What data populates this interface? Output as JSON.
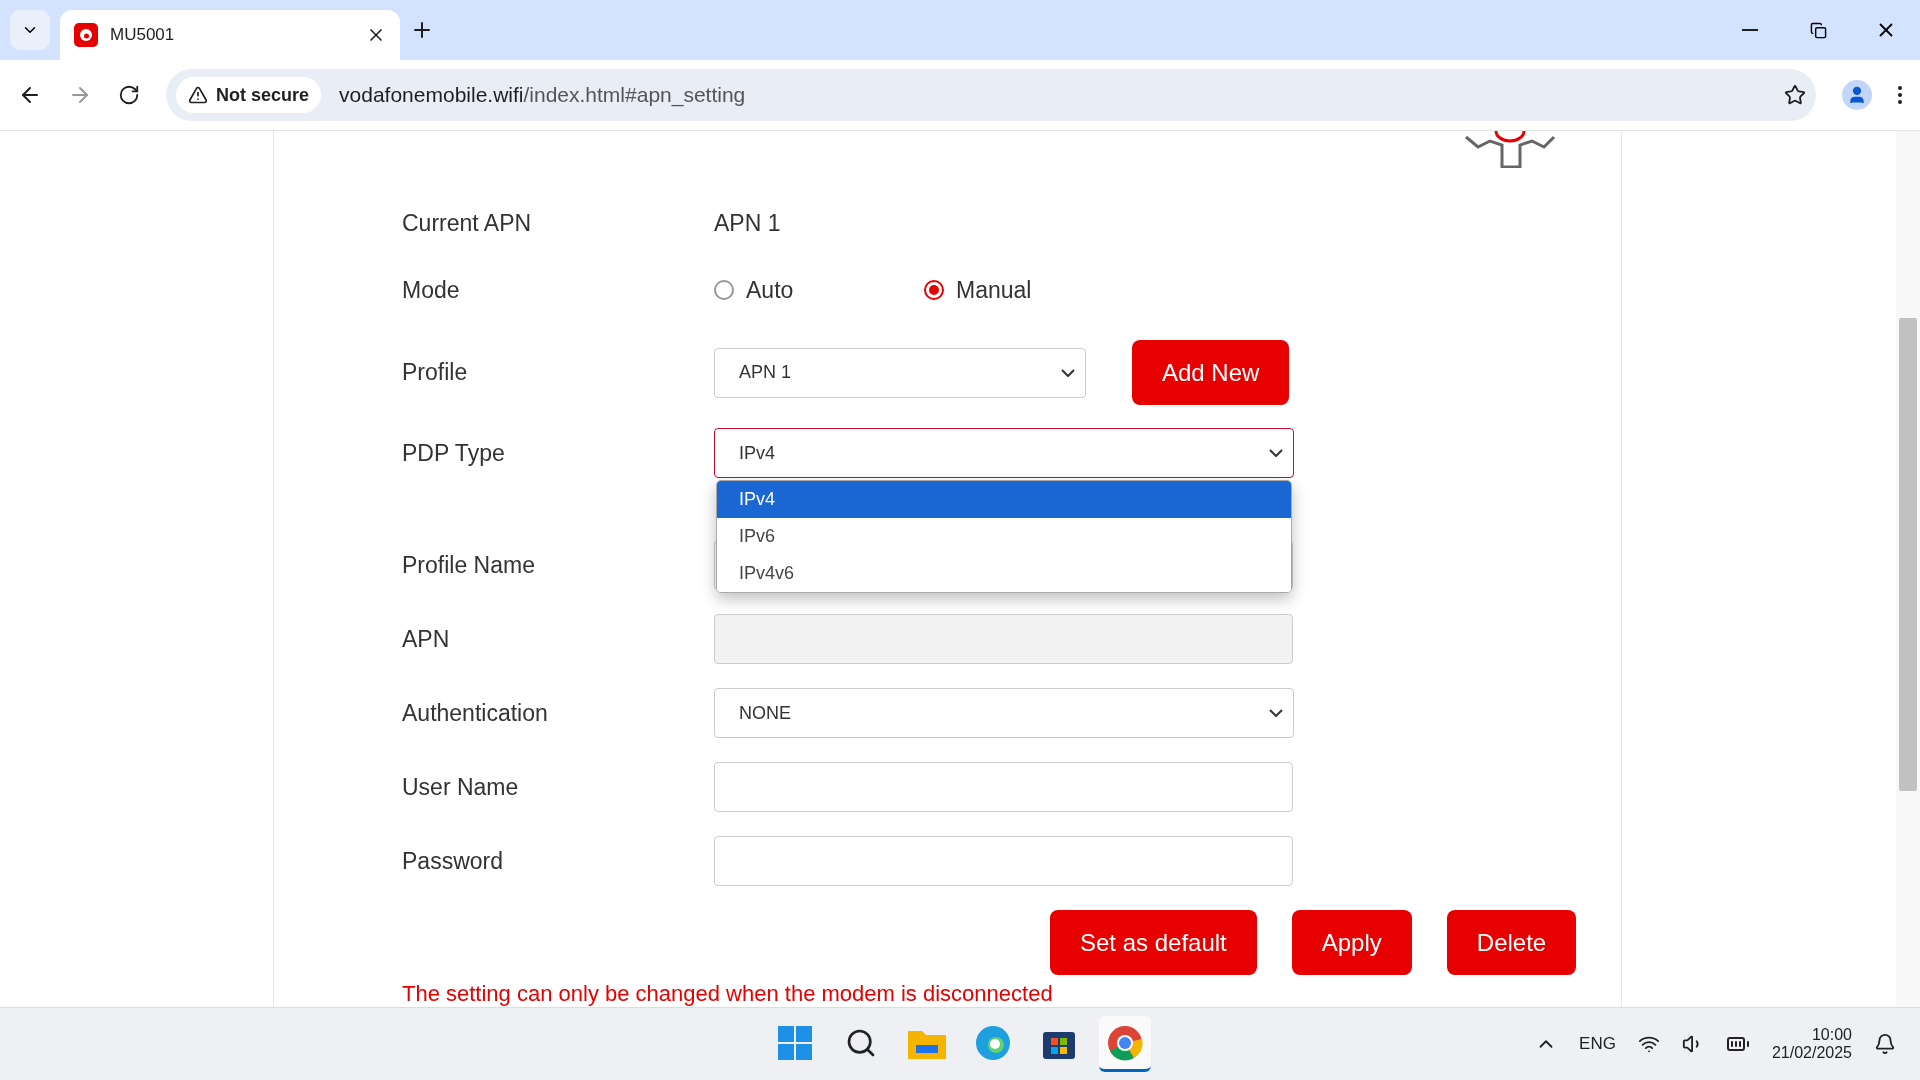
{
  "browser": {
    "tab_title": "MU5001",
    "security_label": "Not secure",
    "url_host": "vodafonemobile.wifi",
    "url_path": "/index.html#apn_setting"
  },
  "form": {
    "current_apn": {
      "label": "Current APN",
      "value": "APN 1"
    },
    "mode": {
      "label": "Mode",
      "options": [
        {
          "label": "Auto",
          "selected": false
        },
        {
          "label": "Manual",
          "selected": true
        }
      ]
    },
    "profile": {
      "label": "Profile",
      "value": "APN 1",
      "button": "Add New"
    },
    "pdp_type": {
      "label": "PDP Type",
      "value": "IPv4",
      "expanded": true,
      "options": [
        {
          "label": "IPv4",
          "selected": true
        },
        {
          "label": "IPv6",
          "selected": false
        },
        {
          "label": "IPv4v6",
          "selected": false
        }
      ]
    },
    "profile_name": {
      "label": "Profile Name"
    },
    "apn": {
      "label": "APN",
      "disabled": true
    },
    "authentication": {
      "label": "Authentication",
      "value": "NONE"
    },
    "user_name": {
      "label": "User Name"
    },
    "password": {
      "label": "Password"
    },
    "buttons": [
      "Set as default",
      "Apply",
      "Delete"
    ],
    "note": "The setting can only be changed when the modem is disconnected"
  },
  "taskbar": {
    "apps": [
      {
        "kind": "start",
        "selected": false
      },
      {
        "kind": "search",
        "selected": false
      },
      {
        "kind": "files",
        "selected": false
      },
      {
        "kind": "edge",
        "selected": false
      },
      {
        "kind": "store",
        "selected": false
      },
      {
        "kind": "chrome",
        "selected": true
      }
    ],
    "language": "ENG",
    "time": "10:00",
    "date": "21/02/2025"
  }
}
